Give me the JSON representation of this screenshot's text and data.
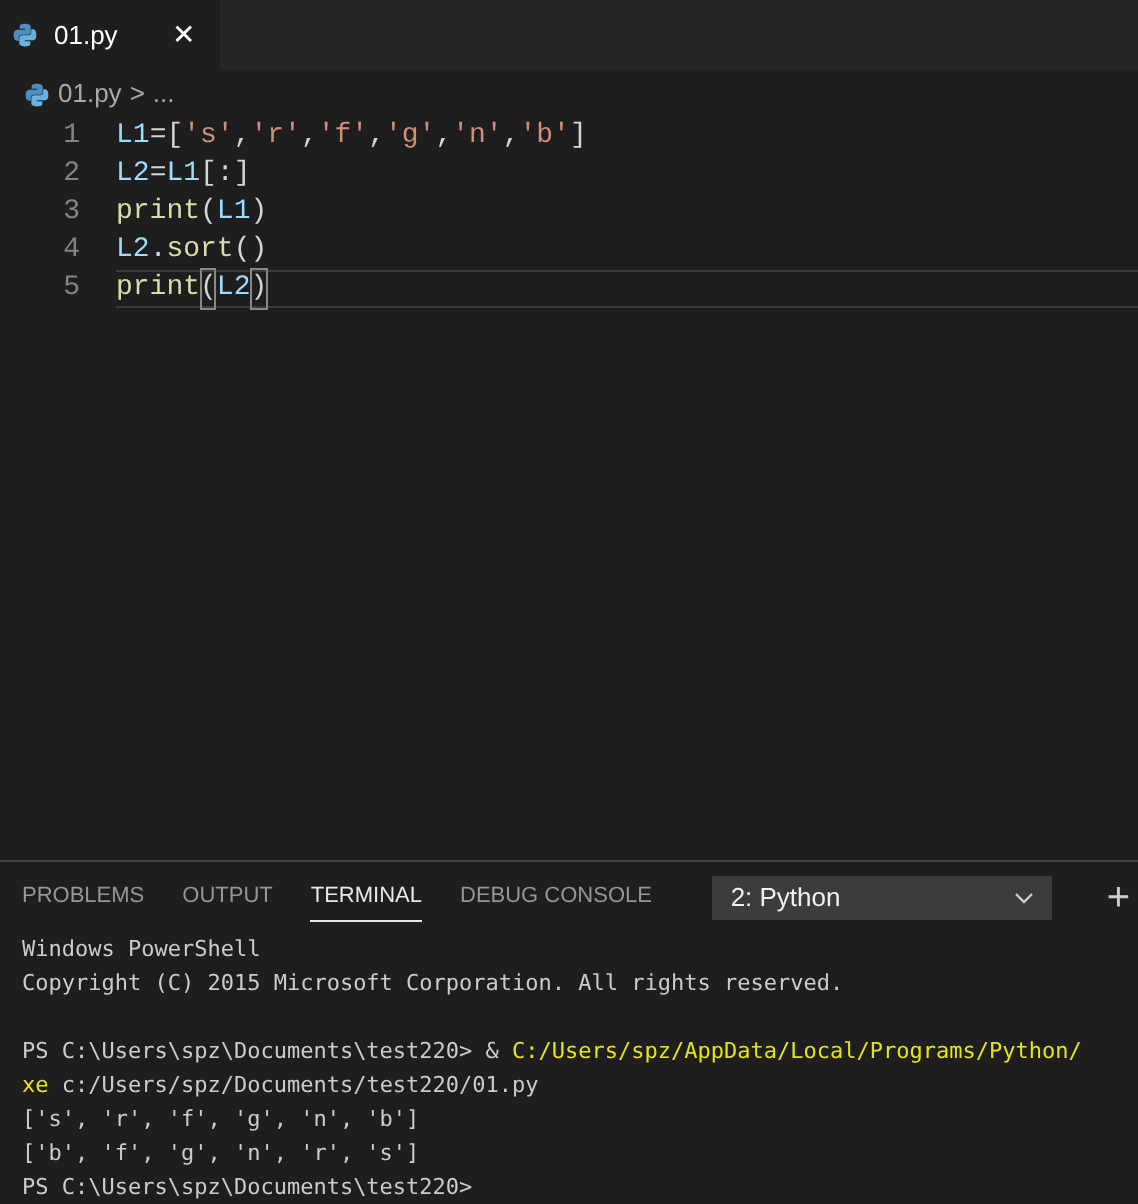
{
  "tabs": [
    {
      "label": "01.py",
      "selected": true,
      "close": "✕"
    }
  ],
  "breadcrumb": {
    "file": "01.py",
    "separator": ">",
    "rest": "..."
  },
  "code_lines": [
    {
      "number": "1",
      "current": false,
      "tokens": [
        {
          "text": "L1",
          "kind": "var"
        },
        {
          "text": "=[",
          "kind": "plain"
        },
        {
          "text": "'s'",
          "kind": "string"
        },
        {
          "text": ",",
          "kind": "plain"
        },
        {
          "text": "'r'",
          "kind": "string"
        },
        {
          "text": ",",
          "kind": "plain"
        },
        {
          "text": "'f'",
          "kind": "string"
        },
        {
          "text": ",",
          "kind": "plain"
        },
        {
          "text": "'g'",
          "kind": "string"
        },
        {
          "text": ",",
          "kind": "plain"
        },
        {
          "text": "'n'",
          "kind": "string"
        },
        {
          "text": ",",
          "kind": "plain"
        },
        {
          "text": "'b'",
          "kind": "string"
        },
        {
          "text": "]",
          "kind": "plain"
        }
      ]
    },
    {
      "number": "2",
      "current": false,
      "tokens": [
        {
          "text": "L2",
          "kind": "var"
        },
        {
          "text": "=",
          "kind": "plain"
        },
        {
          "text": "L1",
          "kind": "var"
        },
        {
          "text": "[:]",
          "kind": "plain"
        }
      ]
    },
    {
      "number": "3",
      "current": false,
      "tokens": [
        {
          "text": "print",
          "kind": "func"
        },
        {
          "text": "(",
          "kind": "plain"
        },
        {
          "text": "L1",
          "kind": "var"
        },
        {
          "text": ")",
          "kind": "plain"
        }
      ]
    },
    {
      "number": "4",
      "current": false,
      "tokens": [
        {
          "text": "L2",
          "kind": "var"
        },
        {
          "text": ".",
          "kind": "plain"
        },
        {
          "text": "sort",
          "kind": "func"
        },
        {
          "text": "()",
          "kind": "plain"
        }
      ]
    },
    {
      "number": "5",
      "current": true,
      "tokens": [
        {
          "text": "print",
          "kind": "func"
        },
        {
          "text": "(",
          "kind": "bracket"
        },
        {
          "text": "L2",
          "kind": "var"
        },
        {
          "text": ")",
          "kind": "bracket"
        }
      ]
    }
  ],
  "panel": {
    "tabs": [
      {
        "label": "PROBLEMS",
        "selected": false
      },
      {
        "label": "OUTPUT",
        "selected": false
      },
      {
        "label": "TERMINAL",
        "selected": true
      },
      {
        "label": "DEBUG CONSOLE",
        "selected": false
      }
    ],
    "terminal_select": "2: Python",
    "add": "+"
  },
  "terminal_blocks": [
    [
      [
        {
          "text": "Windows PowerShell",
          "kind": "plain"
        }
      ],
      [
        {
          "text": "Copyright (C) 2015 Microsoft Corporation. All rights reserved.",
          "kind": "plain"
        }
      ]
    ],
    [
      [
        {
          "text": "PS C:\\Users\\spz\\Documents\\test220> & ",
          "kind": "plain"
        },
        {
          "text": "C:/Users/spz/AppData/Local/Programs/Python/",
          "kind": "command"
        }
      ],
      [
        {
          "text": "xe",
          "kind": "command"
        },
        {
          "text": " c:/Users/spz/Documents/test220/01.py",
          "kind": "plain"
        }
      ],
      [
        {
          "text": "['s', 'r', 'f', 'g', 'n', 'b']",
          "kind": "plain"
        }
      ],
      [
        {
          "text": "['b', 'f', 'g', 'n', 'r', 's']",
          "kind": "plain"
        }
      ],
      [
        {
          "text": "PS C:\\Users\\spz\\Documents\\test220>",
          "kind": "plain"
        }
      ]
    ]
  ]
}
